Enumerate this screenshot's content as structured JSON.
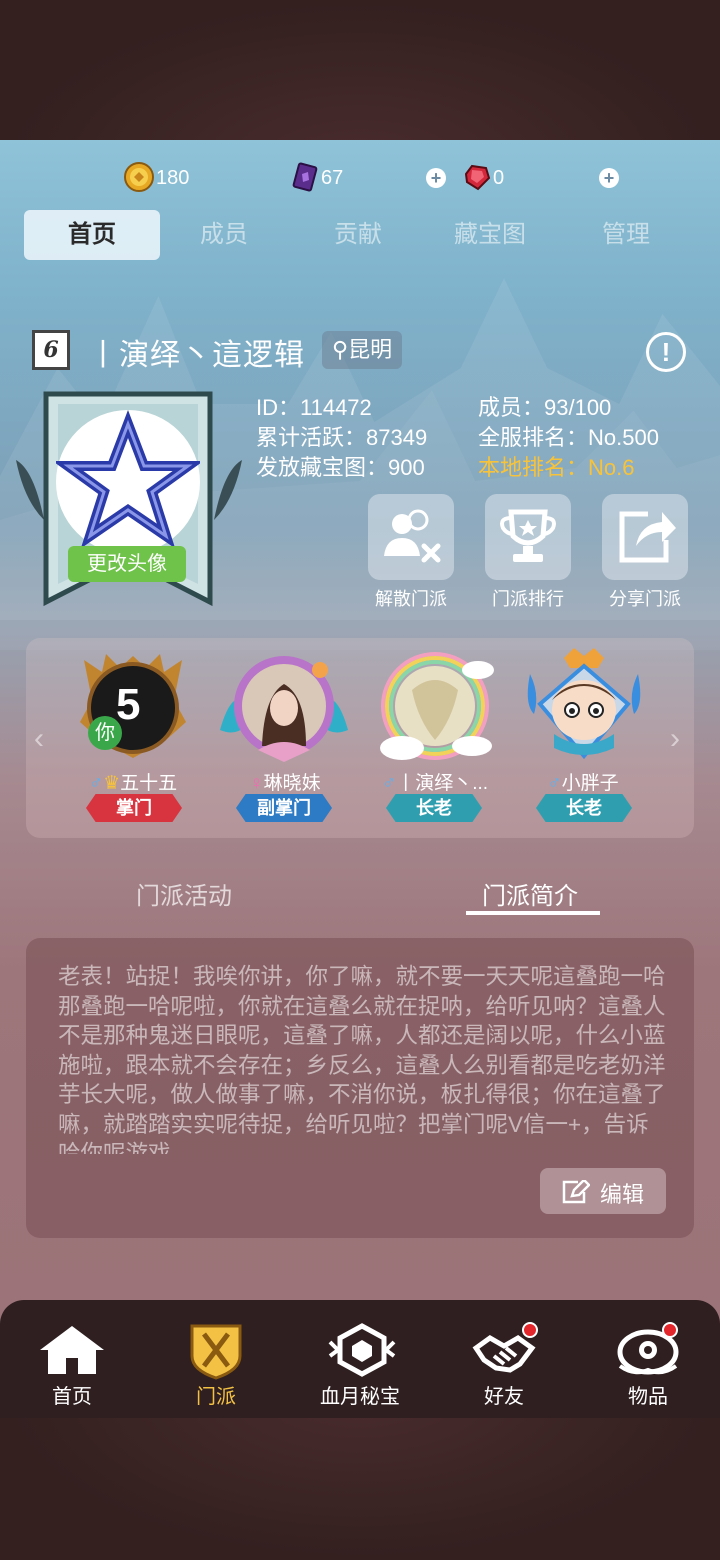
{
  "currency": {
    "gold": "180",
    "gem": "67",
    "ruby": "0"
  },
  "tabs": [
    "首页",
    "成员",
    "贡献",
    "藏宝图",
    "管理"
  ],
  "guild": {
    "level": "6",
    "name": "丨演绎丶這逻辑",
    "location": "昆明",
    "change_avatar": "更改头像",
    "stats": {
      "id": "ID：114472",
      "members": "成员：93/100",
      "activity": "累计活跃：87349",
      "server_rank": "全服排名：No.500",
      "maps_issued": "发放藏宝图：900",
      "local_rank": "本地排名：No.6"
    },
    "actions": [
      "解散门派",
      "门派排行",
      "分享门派"
    ]
  },
  "members": [
    {
      "name": "五十五",
      "role": "掌门",
      "level": "5",
      "you": "你",
      "gender": "♂"
    },
    {
      "name": "琳晓妹",
      "role": "副掌门",
      "gender": "♀"
    },
    {
      "name": "丨演绎丶...",
      "role": "长老",
      "gender": "♂"
    },
    {
      "name": "小胖子",
      "role": "长老",
      "gender": "♂"
    }
  ],
  "subtabs": [
    "门派活动",
    "门派简介"
  ],
  "intro": {
    "text": "老表！站捉！我唉你讲，你了嘛，就不要一天天呢這叠跑一哈那叠跑一哈呢啦，你就在這叠么就在捉呐，给听见呐？這叠人不是那种鬼迷日眼呢，這叠了嘛，人都还是阔以呢，什么小蓝施啦，跟本就不会存在；乡反么，這叠人么别看都是吃老奶洋芋长大呢，做人做事了嘛，不消你说，板扎得很；你在這叠了嘛，就踏踏实实呢待捉，给听见啦？把掌门呢V信一+，告诉哈你呢游戏",
    "edit": "编辑"
  },
  "nav": [
    "首页",
    "门派",
    "血月秘宝",
    "好友",
    "物品"
  ],
  "colors": {
    "gold_text": "#f7c33a",
    "role_master": "#d8343f",
    "role_vice": "#2d7bc4",
    "role_elder": "#2f9fb0",
    "nav_active": "#f3c244",
    "badge_red": "#e2262c"
  }
}
